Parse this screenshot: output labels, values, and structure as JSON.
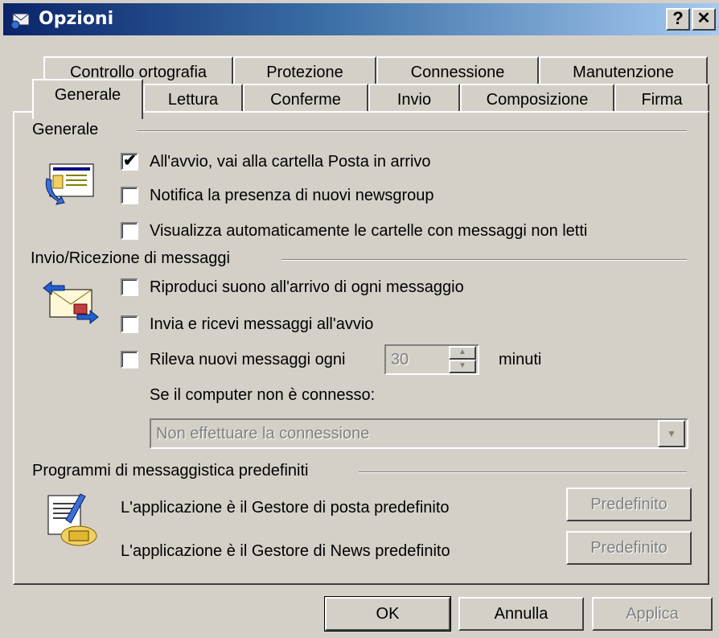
{
  "window": {
    "title": "Opzioni",
    "help_glyph": "?",
    "close_glyph": "✕"
  },
  "tabs_back": [
    {
      "label": "Controllo ortografia"
    },
    {
      "label": "Protezione"
    },
    {
      "label": "Connessione"
    },
    {
      "label": "Manutenzione"
    }
  ],
  "tabs_front": [
    {
      "label": "Generale",
      "active": true
    },
    {
      "label": "Lettura"
    },
    {
      "label": "Conferme"
    },
    {
      "label": "Invio"
    },
    {
      "label": "Composizione"
    },
    {
      "label": "Firma"
    }
  ],
  "general": {
    "heading": "Generale",
    "icon": "mail-folder-icon",
    "options": [
      {
        "label": "All'avvio, vai alla cartella Posta in arrivo",
        "checked": true
      },
      {
        "label": "Notifica la presenza di nuovi newsgroup",
        "checked": false
      },
      {
        "label": "Visualizza automaticamente le cartelle con messaggi non letti",
        "checked": false
      }
    ]
  },
  "send_receive": {
    "heading": "Invio/Ricezione di messaggi",
    "icon": "send-receive-icon",
    "options": [
      {
        "label": "Riproduci suono all'arrivo di ogni messaggio",
        "checked": false
      },
      {
        "label": "Invia e ricevi messaggi all'avvio",
        "checked": false
      },
      {
        "label": "Rileva nuovi messaggi ogni",
        "checked": false
      }
    ],
    "interval_value": "30",
    "interval_unit": "minuti",
    "offline_label": "Se il computer non è connesso:",
    "offline_selected": "Non effettuare la connessione"
  },
  "default_programs": {
    "heading": "Programmi di messaggistica predefiniti",
    "icon": "default-programs-icon",
    "mail_text": "L'applicazione è il Gestore di posta predefinito",
    "news_text": "L'applicazione è il Gestore di News predefinito",
    "mail_button": "Predefinito",
    "news_button": "Predefinito"
  },
  "footer": {
    "ok": "OK",
    "cancel": "Annulla",
    "apply": "Applica"
  }
}
